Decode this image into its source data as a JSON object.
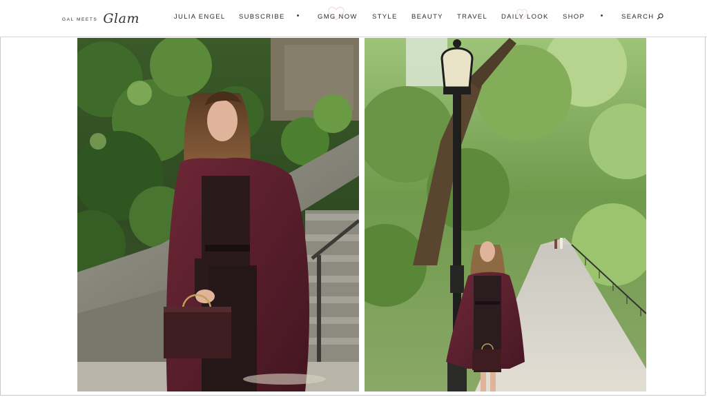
{
  "logo": {
    "small_text": "GAL MEETS",
    "script_text": "Glam"
  },
  "nav": {
    "items": [
      {
        "label": "JULIA ENGEL"
      },
      {
        "label": "SUBSCRIBE"
      },
      {
        "label": "GMG NOW"
      },
      {
        "label": "STYLE"
      },
      {
        "label": "BEAUTY"
      },
      {
        "label": "TRAVEL"
      },
      {
        "label": "DAILY LOOK"
      },
      {
        "label": "SHOP"
      }
    ],
    "search_label": "SEARCH"
  },
  "colors": {
    "accent_heart": "#e7bfc2",
    "coat": "#5b1f2c",
    "foliage": "#3f6a2a"
  },
  "icons": {
    "search": "magnifier-icon",
    "heart": "heart-outline-icon"
  }
}
